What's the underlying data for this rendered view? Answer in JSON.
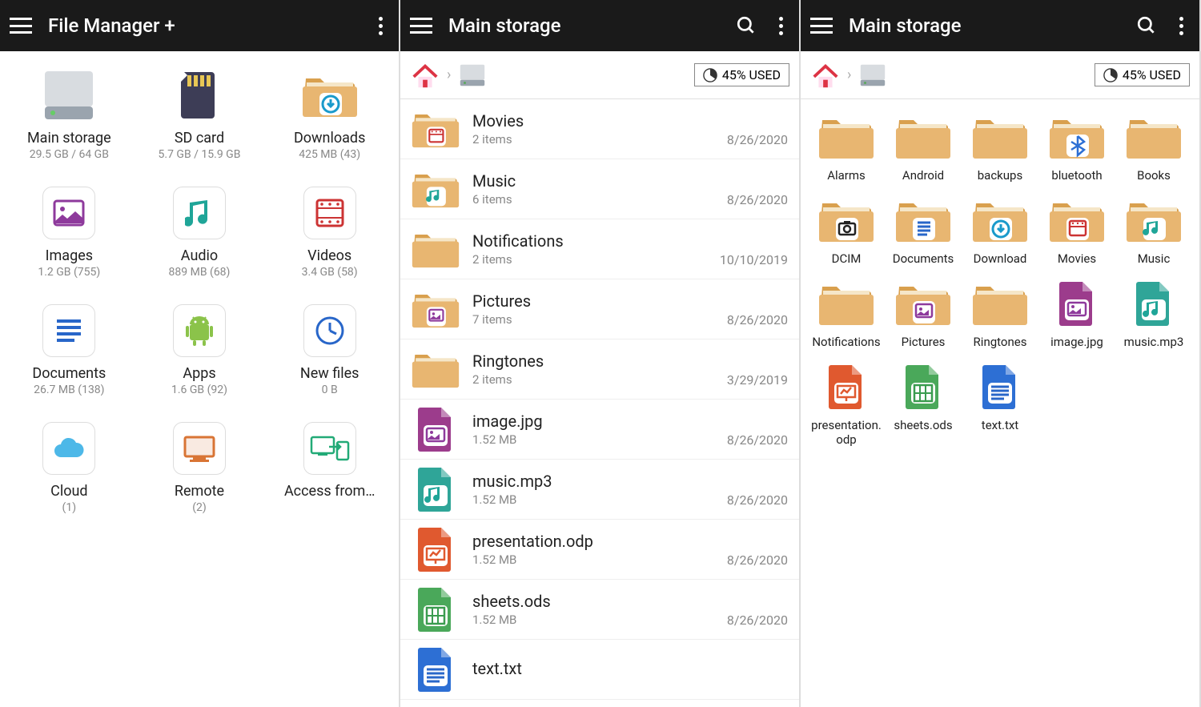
{
  "screen1": {
    "title": "File Manager +",
    "categories": [
      {
        "name": "Main storage",
        "sub": "29.5 GB / 64 GB",
        "icon": "hdd"
      },
      {
        "name": "SD card",
        "sub": "5.7 GB / 15.9 GB",
        "icon": "sdcard"
      },
      {
        "name": "Downloads",
        "sub": "425 MB (43)",
        "icon": "folder-download"
      },
      {
        "name": "Images",
        "sub": "1.2 GB (755)",
        "icon": "image"
      },
      {
        "name": "Audio",
        "sub": "889 MB (68)",
        "icon": "audio"
      },
      {
        "name": "Videos",
        "sub": "3.4 GB (58)",
        "icon": "video"
      },
      {
        "name": "Documents",
        "sub": "26.7 MB (138)",
        "icon": "document"
      },
      {
        "name": "Apps",
        "sub": "1.6 GB (92)",
        "icon": "apps"
      },
      {
        "name": "New files",
        "sub": "0 B",
        "icon": "clock"
      },
      {
        "name": "Cloud",
        "sub": "(1)",
        "icon": "cloud"
      },
      {
        "name": "Remote",
        "sub": "(2)",
        "icon": "remote"
      },
      {
        "name": "Access from…",
        "sub": "",
        "icon": "access"
      }
    ]
  },
  "screen2": {
    "title": "Main storage",
    "usage": "45% USED",
    "items": [
      {
        "name": "Movies",
        "sub": "2 items",
        "date": "8/26/2020",
        "icon": "folder-video"
      },
      {
        "name": "Music",
        "sub": "6 items",
        "date": "8/26/2020",
        "icon": "folder-music"
      },
      {
        "name": "Notifications",
        "sub": "2 items",
        "date": "10/10/2019",
        "icon": "folder"
      },
      {
        "name": "Pictures",
        "sub": "7 items",
        "date": "8/26/2020",
        "icon": "folder-image"
      },
      {
        "name": "Ringtones",
        "sub": "2 items",
        "date": "3/29/2019",
        "icon": "folder"
      },
      {
        "name": "image.jpg",
        "sub": "1.52 MB",
        "date": "8/26/2020",
        "icon": "file-image"
      },
      {
        "name": "music.mp3",
        "sub": "1.52 MB",
        "date": "8/26/2020",
        "icon": "file-music"
      },
      {
        "name": "presentation.odp",
        "sub": "1.52 MB",
        "date": "8/26/2020",
        "icon": "file-presentation"
      },
      {
        "name": "sheets.ods",
        "sub": "1.52 MB",
        "date": "8/26/2020",
        "icon": "file-sheets"
      },
      {
        "name": "text.txt",
        "sub": "",
        "date": "",
        "icon": "file-text"
      }
    ]
  },
  "screen3": {
    "title": "Main storage",
    "usage": "45% USED",
    "items": [
      {
        "name": "Alarms",
        "icon": "folder"
      },
      {
        "name": "Android",
        "icon": "folder"
      },
      {
        "name": "backups",
        "icon": "folder"
      },
      {
        "name": "bluetooth",
        "icon": "folder-bluetooth"
      },
      {
        "name": "Books",
        "icon": "folder"
      },
      {
        "name": "DCIM",
        "icon": "folder-camera"
      },
      {
        "name": "Documents",
        "icon": "folder-document"
      },
      {
        "name": "Download",
        "icon": "folder-download"
      },
      {
        "name": "Movies",
        "icon": "folder-video"
      },
      {
        "name": "Music",
        "icon": "folder-music"
      },
      {
        "name": "Notifications",
        "icon": "folder"
      },
      {
        "name": "Pictures",
        "icon": "folder-image"
      },
      {
        "name": "Ringtones",
        "icon": "folder"
      },
      {
        "name": "image.jpg",
        "icon": "file-image"
      },
      {
        "name": "music.mp3",
        "icon": "file-music"
      },
      {
        "name": "presentation.odp",
        "icon": "file-presentation"
      },
      {
        "name": "sheets.ods",
        "icon": "file-sheets"
      },
      {
        "name": "text.txt",
        "icon": "file-text"
      }
    ]
  }
}
